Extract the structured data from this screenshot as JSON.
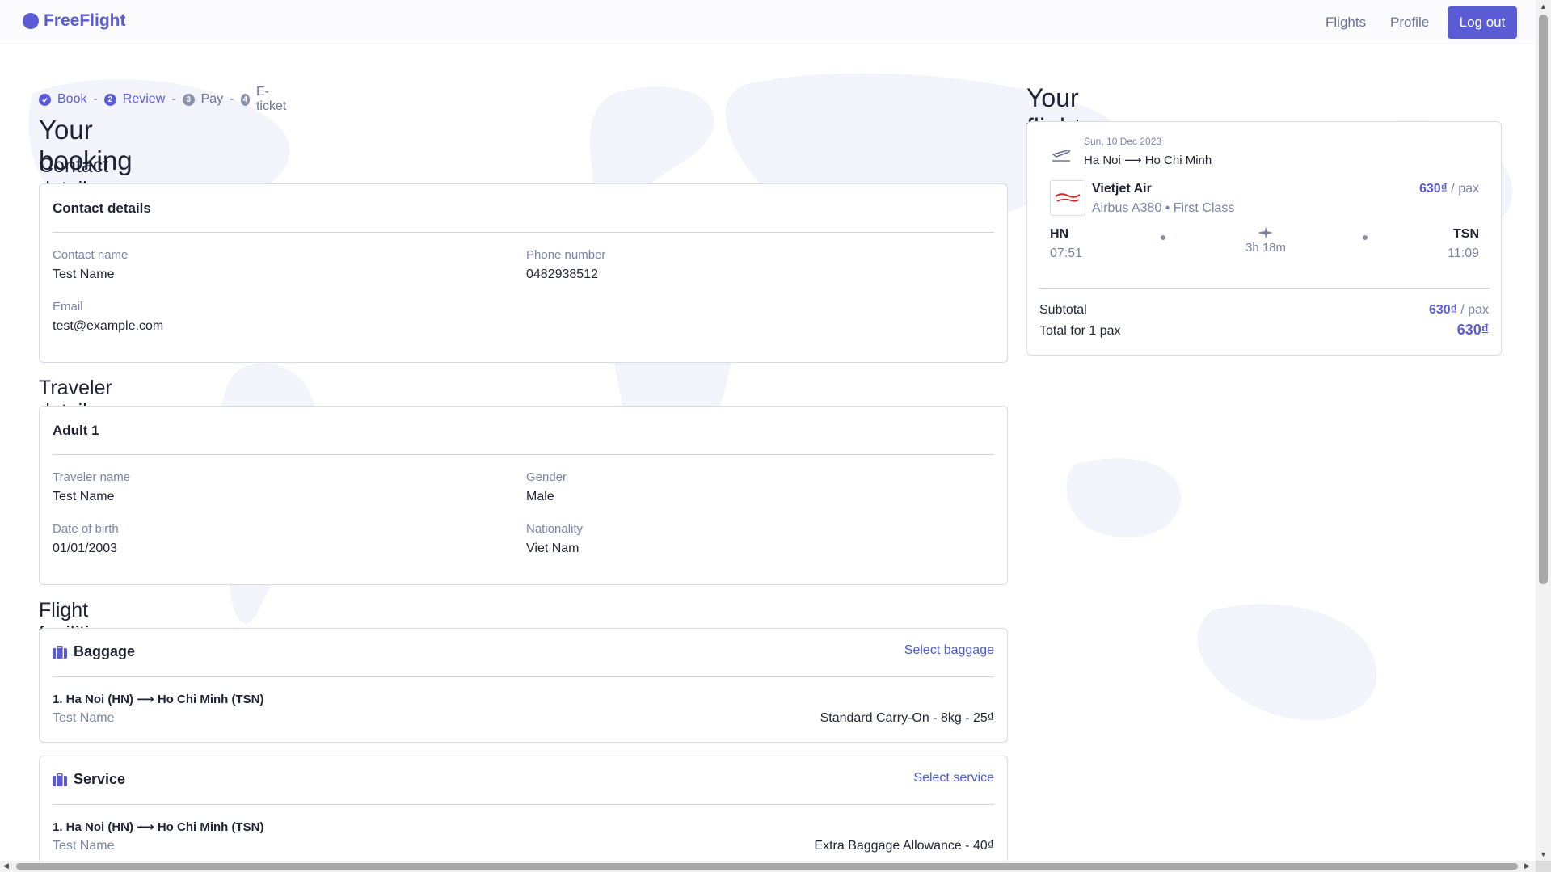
{
  "nav": {
    "brand": "FreeFlight",
    "links": [
      "Flights",
      "Profile"
    ],
    "logout": "Log out"
  },
  "steps": [
    {
      "num": "",
      "label": "Book"
    },
    {
      "num": "2",
      "label": "Review"
    },
    {
      "num": "3",
      "label": "Pay"
    },
    {
      "num": "4",
      "label": "E-ticket"
    }
  ],
  "page_title": "Your booking",
  "contact": {
    "section_title": "Contact details",
    "card_title": "Contact details",
    "name_label": "Contact name",
    "name_value": "Test Name",
    "phone_label": "Phone number",
    "phone_value": "0482938512",
    "email_label": "Email",
    "email_value": "test@example.com"
  },
  "traveler": {
    "section_title": "Traveler details",
    "card_title": "Adult 1",
    "name_label": "Traveler name",
    "name_value": "Test Name",
    "gender_label": "Gender",
    "gender_value": "Male",
    "dob_label": "Date of birth",
    "dob_value": "01/01/2003",
    "nationality_label": "Nationality",
    "nationality_value": "Viet Nam"
  },
  "facilities": {
    "section_title": "Flight facilities",
    "baggage": {
      "title": "Baggage",
      "link": "Select baggage",
      "route": "1. Ha Noi (HN) ⟶ Ho Chi Minh (TSN)",
      "pax": "Test Name",
      "value": "Standard Carry-On - 8kg - 25₫"
    },
    "service": {
      "title": "Service",
      "link": "Select service",
      "route": "1. Ha Noi (HN) ⟶ Ho Chi Minh (TSN)",
      "pax": "Test Name",
      "value": "Extra Baggage Allowance - 40₫"
    }
  },
  "flights": {
    "title": "Your flights",
    "date": "Sun, 10 Dec 2023",
    "route": "Ha Noi ⟶ Ho Chi Minh",
    "airline": "Vietjet Air",
    "aircraft": "Airbus A380 • First Class",
    "price": "630₫",
    "per_pax": " / pax",
    "from_code": "HN",
    "from_time": "07:51",
    "to_code": "TSN",
    "to_time": "11:09",
    "duration": "3h 18m",
    "subtotal_label": "Subtotal",
    "subtotal_value": "630₫",
    "total_label": "Total for 1 pax",
    "total_value": "630₫"
  },
  "colors": {
    "accent": "#5b5bd6",
    "link": "#4a5ad8",
    "muted": "#7a83a3",
    "border": "#d8dbe6"
  },
  "icons": [
    "check-circle-icon",
    "suitcase-icon",
    "takeoff-icon",
    "airplane-icon",
    "vietjet-logo"
  ]
}
